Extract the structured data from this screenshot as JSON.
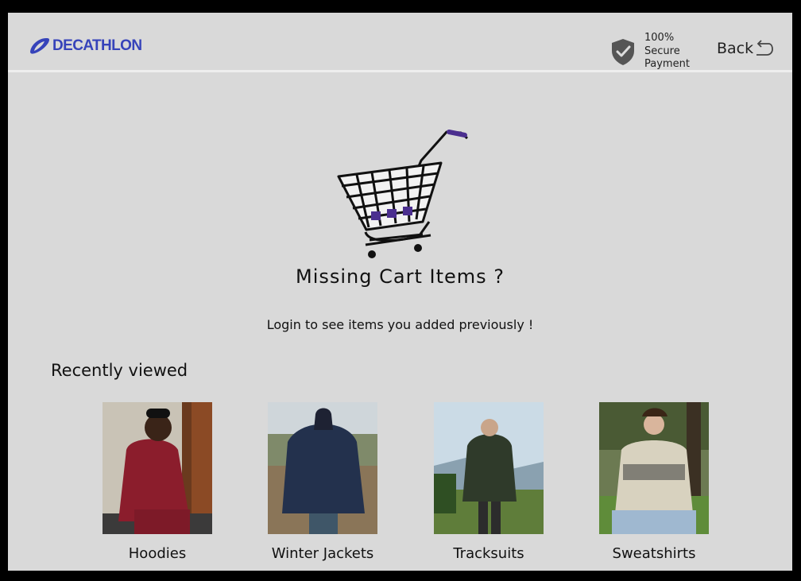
{
  "header": {
    "brand": "DECATHLON",
    "secure_lines": [
      "100%",
      "Secure",
      "Payment"
    ],
    "back_label": "Back"
  },
  "empty_cart": {
    "title": "Missing Cart Items ?",
    "message": "Login to see items you added previously !"
  },
  "recently_viewed": {
    "heading": "Recently viewed",
    "items": [
      {
        "label": "Hoodies",
        "icon": "hoodie-photo"
      },
      {
        "label": "Winter Jackets",
        "icon": "jacket-photo"
      },
      {
        "label": "Tracksuits",
        "icon": "tracksuit-photo"
      },
      {
        "label": "Sweatshirts",
        "icon": "sweatshirt-photo"
      }
    ]
  },
  "colors": {
    "brand": "#3643ba",
    "background": "#d9d9d9",
    "cart_accent": "#4b2f8f"
  }
}
